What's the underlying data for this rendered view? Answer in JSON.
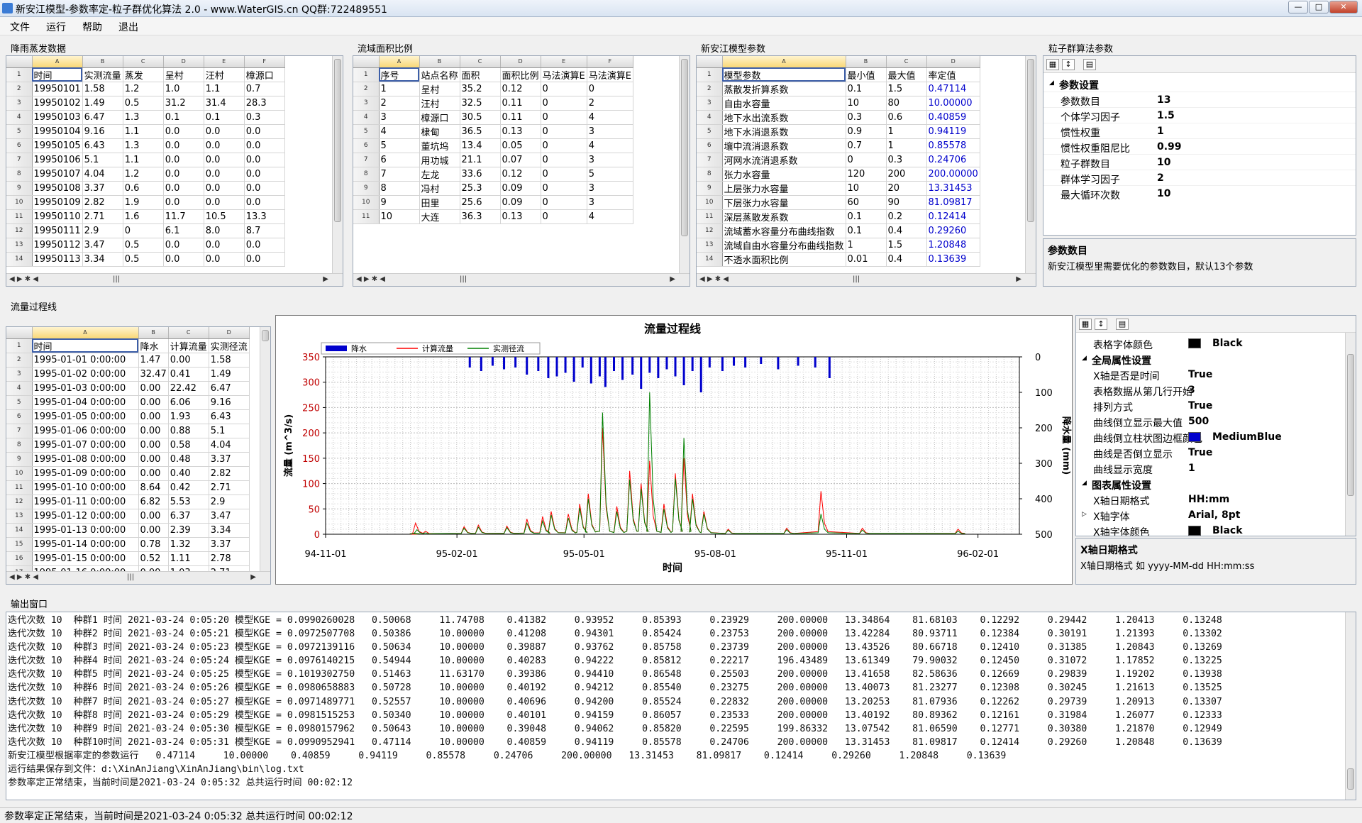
{
  "window": {
    "title": "新安江模型-参数率定-粒子群优化算法 2.0 - www.WaterGIS.cn QQ群:722489551"
  },
  "menu": [
    "文件",
    "运行",
    "帮助",
    "退出"
  ],
  "panels": {
    "rain": "降雨蒸发数据",
    "area": "流域面积比例",
    "params": "新安江模型参数",
    "pso": "粒子群算法参数",
    "flow": "流量过程线",
    "output": "输出窗口"
  },
  "rain_grid": {
    "colletters": [
      "A",
      "B",
      "C",
      "D",
      "E",
      "F"
    ],
    "rows": [
      [
        "时间",
        "实测流量",
        "蒸发",
        "呈村",
        "汪村",
        "樟源口"
      ],
      [
        "19950101",
        "1.58",
        "1.2",
        "1.0",
        "1.1",
        "0.7"
      ],
      [
        "19950102",
        "1.49",
        "0.5",
        "31.2",
        "31.4",
        "28.3"
      ],
      [
        "19950103",
        "6.47",
        "1.3",
        "0.1",
        "0.1",
        "0.3"
      ],
      [
        "19950104",
        "9.16",
        "1.1",
        "0.0",
        "0.0",
        "0.0"
      ],
      [
        "19950105",
        "6.43",
        "1.3",
        "0.0",
        "0.0",
        "0.0"
      ],
      [
        "19950106",
        "5.1",
        "1.1",
        "0.0",
        "0.0",
        "0.0"
      ],
      [
        "19950107",
        "4.04",
        "1.2",
        "0.0",
        "0.0",
        "0.0"
      ],
      [
        "19950108",
        "3.37",
        "0.6",
        "0.0",
        "0.0",
        "0.0"
      ],
      [
        "19950109",
        "2.82",
        "1.9",
        "0.0",
        "0.0",
        "0.0"
      ],
      [
        "19950110",
        "2.71",
        "1.6",
        "11.7",
        "10.5",
        "13.3"
      ],
      [
        "19950111",
        "2.9",
        "0",
        "6.1",
        "8.0",
        "8.7"
      ],
      [
        "19950112",
        "3.47",
        "0.5",
        "0.0",
        "0.0",
        "0.0"
      ],
      [
        "19950113",
        "3.34",
        "0.5",
        "0.0",
        "0.0",
        "0.0"
      ]
    ]
  },
  "area_grid": {
    "colletters": [
      "A",
      "B",
      "C",
      "D",
      "E",
      "F"
    ],
    "rows": [
      [
        "序号",
        "站点名称",
        "面积",
        "面积比例",
        "马法演算E",
        "马法演算E"
      ],
      [
        "1",
        "呈村",
        "35.2",
        "0.12",
        "0",
        "0"
      ],
      [
        "2",
        "汪村",
        "32.5",
        "0.11",
        "0",
        "2"
      ],
      [
        "3",
        "樟源口",
        "30.5",
        "0.11",
        "0",
        "4"
      ],
      [
        "4",
        "棣甸",
        "36.5",
        "0.13",
        "0",
        "3"
      ],
      [
        "5",
        "董坑坞",
        "13.4",
        "0.05",
        "0",
        "4"
      ],
      [
        "6",
        "用功城",
        "21.1",
        "0.07",
        "0",
        "3"
      ],
      [
        "7",
        "左龙",
        "33.6",
        "0.12",
        "0",
        "5"
      ],
      [
        "8",
        "冯村",
        "25.3",
        "0.09",
        "0",
        "3"
      ],
      [
        "9",
        "田里",
        "25.6",
        "0.09",
        "0",
        "3"
      ],
      [
        "10",
        "大连",
        "36.3",
        "0.13",
        "0",
        "4"
      ]
    ]
  },
  "param_grid": {
    "colletters": [
      "A",
      "B",
      "C",
      "D"
    ],
    "rows": [
      [
        "模型参数",
        "最小值",
        "最大值",
        "率定值"
      ],
      [
        "蒸散发折算系数",
        "0.1",
        "1.5",
        "0.47114"
      ],
      [
        "自由水容量",
        "10",
        "80",
        "10.00000"
      ],
      [
        "地下水出流系数",
        "0.3",
        "0.6",
        "0.40859"
      ],
      [
        "地下水消退系数",
        "0.9",
        "1",
        "0.94119"
      ],
      [
        "壤中流消退系数",
        "0.7",
        "1",
        "0.85578"
      ],
      [
        "河网水流消退系数",
        "0",
        "0.3",
        "0.24706"
      ],
      [
        "张力水容量",
        "120",
        "200",
        "200.00000"
      ],
      [
        "上层张力水容量",
        "10",
        "20",
        "13.31453"
      ],
      [
        "下层张力水容量",
        "60",
        "90",
        "81.09817"
      ],
      [
        "深层蒸散发系数",
        "0.1",
        "0.2",
        "0.12414"
      ],
      [
        "流域蓄水容量分布曲线指数",
        "0.1",
        "0.4",
        "0.29260"
      ],
      [
        "流域自由水容量分布曲线指数",
        "1",
        "1.5",
        "1.20848"
      ],
      [
        "不透水面积比例",
        "0.01",
        "0.4",
        "0.13639"
      ]
    ]
  },
  "pso_props": {
    "category": "参数设置",
    "items": [
      [
        "参数数目",
        "13"
      ],
      [
        "个体学习因子",
        "1.5"
      ],
      [
        "惯性权重",
        "1"
      ],
      [
        "惯性权重阻尼比",
        "0.99"
      ],
      [
        "粒子群数目",
        "10"
      ],
      [
        "群体学习因子",
        "2"
      ],
      [
        "最大循环次数",
        "10"
      ]
    ],
    "desc_title": "参数数目",
    "desc_text": "新安江模型里需要优化的参数数目，默认13个参数"
  },
  "flow_grid": {
    "colletters": [
      "A",
      "B",
      "C",
      "D"
    ],
    "rows": [
      [
        "时间",
        "降水",
        "计算流量",
        "实测径流"
      ],
      [
        "1995-01-01 0:00:00",
        "1.47",
        "0.00",
        "1.58"
      ],
      [
        "1995-01-02 0:00:00",
        "32.47",
        "0.41",
        "1.49"
      ],
      [
        "1995-01-03 0:00:00",
        "0.00",
        "22.42",
        "6.47"
      ],
      [
        "1995-01-04 0:00:00",
        "0.00",
        "6.06",
        "9.16"
      ],
      [
        "1995-01-05 0:00:00",
        "0.00",
        "1.93",
        "6.43"
      ],
      [
        "1995-01-06 0:00:00",
        "0.00",
        "0.88",
        "5.1"
      ],
      [
        "1995-01-07 0:00:00",
        "0.00",
        "0.58",
        "4.04"
      ],
      [
        "1995-01-08 0:00:00",
        "0.00",
        "0.48",
        "3.37"
      ],
      [
        "1995-01-09 0:00:00",
        "0.00",
        "0.40",
        "2.82"
      ],
      [
        "1995-01-10 0:00:00",
        "8.64",
        "0.42",
        "2.71"
      ],
      [
        "1995-01-11 0:00:00",
        "6.82",
        "5.53",
        "2.9"
      ],
      [
        "1995-01-12 0:00:00",
        "0.00",
        "6.37",
        "3.47"
      ],
      [
        "1995-01-13 0:00:00",
        "0.00",
        "2.39",
        "3.34"
      ],
      [
        "1995-01-14 0:00:00",
        "0.78",
        "1.32",
        "3.37"
      ],
      [
        "1995-01-15 0:00:00",
        "0.52",
        "1.11",
        "2.78"
      ],
      [
        "1995-01-16 0:00:00",
        "0.00",
        "1.03",
        "2.71"
      ]
    ]
  },
  "chart_props": {
    "items": [
      {
        "k": "表格字体颜色",
        "v": "Black",
        "swatch": "#000000"
      },
      {
        "cat": "全局属性设置"
      },
      {
        "k": "X轴是否是时间",
        "v": "True"
      },
      {
        "k": "表格数据从第几行开始",
        "v": "3"
      },
      {
        "k": "排列方式",
        "v": "True"
      },
      {
        "k": "曲线倒立显示最大值",
        "v": "500"
      },
      {
        "k": "曲线倒立柱状图边框颜色",
        "v": "MediumBlue",
        "swatch": "#0000cd"
      },
      {
        "k": "曲线是否倒立显示",
        "v": "True"
      },
      {
        "k": "曲线显示宽度",
        "v": "1"
      },
      {
        "cat": "图表属性设置"
      },
      {
        "k": "X轴日期格式",
        "v": "HH:mm"
      },
      {
        "k": "X轴字体",
        "v": "Arial, 8pt",
        "expand": true
      },
      {
        "k": "X轴字体颜色",
        "v": "Black",
        "swatch": "#000000"
      }
    ],
    "desc_title": "X轴日期格式",
    "desc_text": "X轴日期格式 如 yyyy-MM-dd HH:mm:ss"
  },
  "chart_data": {
    "type": "line",
    "title": "流量过程线",
    "xlabel": "时间",
    "ylabel": "流量 (m^3/s)",
    "y2label": "降水量 (mm)",
    "ylim": [
      0,
      350
    ],
    "y2lim": [
      0,
      500
    ],
    "y2_inverted": true,
    "xticks": [
      "94-11-01",
      "95-02-01",
      "95-05-01",
      "95-08-01",
      "95-11-01",
      "96-02-01"
    ],
    "yticks": [
      0,
      50,
      100,
      150,
      200,
      250,
      300,
      350
    ],
    "y2ticks": [
      0,
      100,
      200,
      300,
      400,
      500
    ],
    "legend": [
      "降水",
      "计算流量",
      "实测径流"
    ],
    "colors": {
      "rain": "#0000cd",
      "calc": "#ff0000",
      "obs": "#008000"
    },
    "series": [
      {
        "name": "计算流量",
        "x": [
          "95-01-01",
          "95-01-03",
          "95-01-10",
          "95-02-06",
          "95-02-16",
          "95-03-08",
          "95-03-22",
          "95-04-02",
          "95-04-08",
          "95-04-20",
          "95-04-28",
          "95-05-04",
          "95-05-14",
          "95-05-24",
          "95-06-02",
          "95-06-10",
          "95-06-16",
          "95-06-26",
          "95-07-04",
          "95-07-10",
          "95-07-16",
          "95-07-24",
          "95-08-10",
          "95-09-20",
          "95-10-14",
          "95-11-12",
          "96-01-18"
        ],
        "values": [
          0,
          22,
          6,
          15,
          18,
          16,
          30,
          35,
          45,
          40,
          60,
          80,
          210,
          55,
          125,
          100,
          145,
          60,
          120,
          150,
          80,
          45,
          10,
          12,
          85,
          12,
          10
        ]
      },
      {
        "name": "实测径流",
        "x": [
          "95-01-01",
          "95-01-04",
          "95-01-10",
          "95-02-06",
          "95-02-16",
          "95-03-08",
          "95-03-22",
          "95-04-02",
          "95-04-08",
          "95-04-20",
          "95-04-28",
          "95-05-04",
          "95-05-14",
          "95-05-24",
          "95-06-02",
          "95-06-10",
          "95-06-16",
          "95-06-26",
          "95-07-04",
          "95-07-10",
          "95-07-16",
          "95-07-24",
          "95-08-10",
          "95-09-20",
          "95-10-14",
          "95-11-12",
          "96-01-18"
        ],
        "values": [
          1.6,
          9,
          2.8,
          12,
          14,
          13,
          22,
          26,
          38,
          32,
          52,
          70,
          240,
          45,
          108,
          90,
          280,
          50,
          110,
          190,
          70,
          40,
          8,
          9,
          40,
          8,
          6
        ]
      }
    ],
    "rain_bars": {
      "x": [
        "95-02-10",
        "95-02-18",
        "95-02-26",
        "95-03-06",
        "95-03-14",
        "95-03-22",
        "95-03-30",
        "95-04-06",
        "95-04-12",
        "95-04-18",
        "95-04-24",
        "95-04-30",
        "95-05-06",
        "95-05-12",
        "95-05-16",
        "95-05-22",
        "95-05-28",
        "95-06-04",
        "95-06-10",
        "95-06-16",
        "95-06-22",
        "95-06-28",
        "95-07-04",
        "95-07-10",
        "95-07-16",
        "95-07-22",
        "95-07-28",
        "95-08-06",
        "95-08-14",
        "95-08-22",
        "95-09-02",
        "95-09-14",
        "95-09-28",
        "95-10-10",
        "95-10-20"
      ],
      "values": [
        30,
        40,
        25,
        35,
        30,
        50,
        40,
        60,
        55,
        45,
        70,
        30,
        75,
        55,
        85,
        40,
        65,
        50,
        90,
        45,
        60,
        35,
        55,
        80,
        40,
        100,
        30,
        40,
        25,
        30,
        20,
        35,
        25,
        30,
        60
      ]
    }
  },
  "output": {
    "lines": [
      "迭代次数 10  种群1 时间 2021-03-24 0:05:20 模型KGE = 0.0990260028   0.50068     11.74708    0.41382     0.93952     0.85393     0.23929     200.00000   13.34864    81.68103    0.12292     0.29442     1.20413     0.13248",
      "迭代次数 10  种群2 时间 2021-03-24 0:05:21 模型KGE = 0.0972507708   0.50386     10.00000    0.41208     0.94301     0.85424     0.23753     200.00000   13.42284    80.93711    0.12384     0.30191     1.21393     0.13302",
      "迭代次数 10  种群3 时间 2021-03-24 0:05:23 模型KGE = 0.0972139116   0.50634     10.00000    0.39887     0.93762     0.85758     0.23739     200.00000   13.43526    80.66718    0.12410     0.31385     1.20843     0.13269",
      "迭代次数 10  种群4 时间 2021-03-24 0:05:24 模型KGE = 0.0976140215   0.54944     10.00000    0.40283     0.94222     0.85812     0.22217     196.43489   13.61349    79.90032    0.12450     0.31072     1.17852     0.13225",
      "迭代次数 10  种群5 时间 2021-03-24 0:05:25 模型KGE = 0.1019302750   0.51463     11.63170    0.39386     0.94410     0.86548     0.25503     200.00000   13.41658    82.58636    0.12669     0.29839     1.19202     0.13938",
      "迭代次数 10  种群6 时间 2021-03-24 0:05:26 模型KGE = 0.0980658883   0.50728     10.00000    0.40192     0.94212     0.85540     0.23275     200.00000   13.40073    81.23277    0.12308     0.30245     1.21613     0.13525",
      "迭代次数 10  种群7 时间 2021-03-24 0:05:27 模型KGE = 0.0971489771   0.52557     10.00000    0.40696     0.94200     0.85524     0.22832     200.00000   13.20253    81.07936    0.12262     0.29739     1.20913     0.13307",
      "迭代次数 10  种群8 时间 2021-03-24 0:05:29 模型KGE = 0.0981515253   0.50340     10.00000    0.40101     0.94159     0.86057     0.23533     200.00000   13.40192    80.89362    0.12161     0.31984     1.26077     0.12333",
      "迭代次数 10  种群9 时间 2021-03-24 0:05:30 模型KGE = 0.0980157962   0.50643     10.00000    0.39048     0.94062     0.85820     0.22595     199.86332   13.07542    81.06590    0.12771     0.30380     1.21870     0.12949",
      "迭代次数 10  种群10时间 2021-03-24 0:05:31 模型KGE = 0.0990952941   0.47114     10.00000    0.40859     0.94119     0.85578     0.24706     200.00000   13.31453    81.09817    0.12414     0.29260     1.20848     0.13639",
      "新安江模型根据率定的参数运行   0.47114     10.00000    0.40859     0.94119     0.85578     0.24706     200.00000   13.31453    81.09817    0.12414     0.29260     1.20848     0.13639",
      "运行结果保存到文件：d:\\XinAnJiang\\XinAnJiang\\bin\\log.txt",
      "参数率定正常结束，当前时间是2021-03-24 0:05:32 总共运行时间 00:02:12"
    ]
  },
  "status": "参数率定正常结束，当前时间是2021-03-24 0:05:32 总共运行时间 00:02:12"
}
